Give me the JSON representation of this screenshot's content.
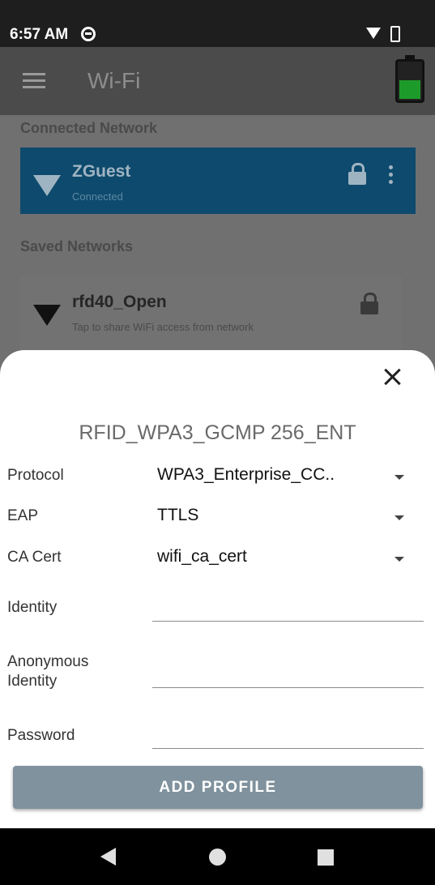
{
  "status_bar": {
    "time": "6:57 AM"
  },
  "app_bar": {
    "title": "Wi-Fi",
    "battery_level": 0.48,
    "battery_color": "#1d9b2a"
  },
  "connected_section": {
    "header": "Connected Network",
    "network": {
      "name": "ZGuest",
      "status": "Connected"
    }
  },
  "saved_section": {
    "header": "Saved Networks",
    "networks": [
      {
        "name": "rfd40_Open",
        "subtitle": "Tap to share WiFi access from network"
      }
    ]
  },
  "dialog": {
    "title": "RFID_WPA3_GCMP 256_ENT",
    "fields": {
      "protocol": {
        "label": "Protocol",
        "value": "WPA3_Enterprise_CC.."
      },
      "eap": {
        "label": "EAP",
        "value": "TTLS"
      },
      "ca_cert": {
        "label": "CA Cert",
        "value": "wifi_ca_cert"
      },
      "identity": {
        "label": "Identity",
        "value": ""
      },
      "anonymous_identity": {
        "label_line1": "Anonymous",
        "label_line2": "Identity",
        "value": ""
      },
      "password": {
        "label": "Password",
        "value": ""
      }
    },
    "add_button_label": "ADD PROFILE",
    "colors": {
      "button": "#7f929d",
      "connected_card": "#0e4a6d"
    }
  }
}
